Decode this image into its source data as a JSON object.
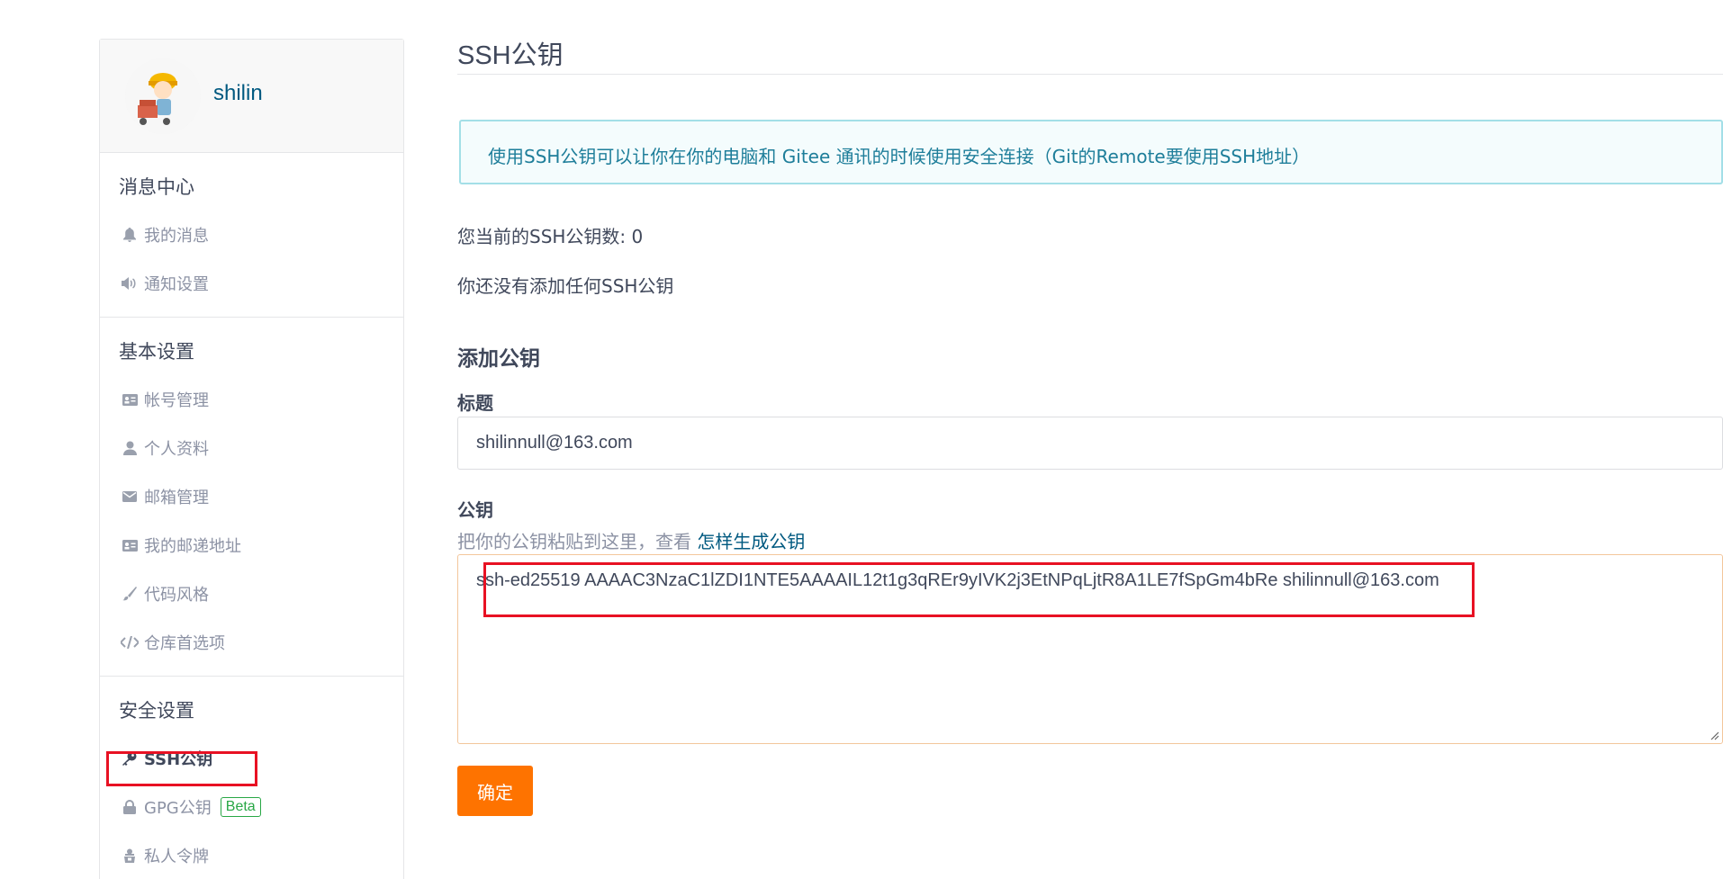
{
  "user": {
    "name": "shilin"
  },
  "sidebar": {
    "sections": [
      {
        "title": "消息中心",
        "items": [
          {
            "label": "我的消息",
            "icon": "bell-icon"
          },
          {
            "label": "通知设置",
            "icon": "speaker-icon"
          }
        ]
      },
      {
        "title": "基本设置",
        "items": [
          {
            "label": "帐号管理",
            "icon": "id-card-icon"
          },
          {
            "label": "个人资料",
            "icon": "user-icon"
          },
          {
            "label": "邮箱管理",
            "icon": "envelope-icon"
          },
          {
            "label": "我的邮递地址",
            "icon": "address-card-icon"
          },
          {
            "label": "代码风格",
            "icon": "brush-icon"
          },
          {
            "label": "仓库首选项",
            "icon": "code-icon"
          }
        ]
      },
      {
        "title": "安全设置",
        "items": [
          {
            "label": "SSH公钥",
            "icon": "key-icon",
            "active": true
          },
          {
            "label": "GPG公钥",
            "icon": "lock-icon",
            "badge": "Beta"
          },
          {
            "label": "私人令牌",
            "icon": "token-icon"
          }
        ]
      }
    ]
  },
  "main": {
    "title": "SSH公钥",
    "info": "使用SSH公钥可以让你在你的电脑和 Gitee 通讯的时候使用安全连接（Git的Remote要使用SSH地址）",
    "count_text": "您当前的SSH公钥数: 0",
    "empty_text": "你还没有添加任何SSH公钥",
    "add_title": "添加公钥",
    "title_label": "标题",
    "title_value": "shilinnull@163.com",
    "key_label": "公钥",
    "key_hint": "把你的公钥粘贴到这里，查看",
    "key_hint_link": "怎样生成公钥",
    "key_value": "ssh-ed25519 AAAAC3NzaC1lZDI1NTE5AAAAIL12t1g3qREr9yIVK2j3EtNPqLjtR8A1LE7fSpGm4bRe shilinnull@163.com",
    "submit_label": "确定"
  },
  "colors": {
    "accent": "#fe7300",
    "link": "#005980",
    "highlight": "#e81123",
    "info_bg": "#f4fcfd"
  }
}
